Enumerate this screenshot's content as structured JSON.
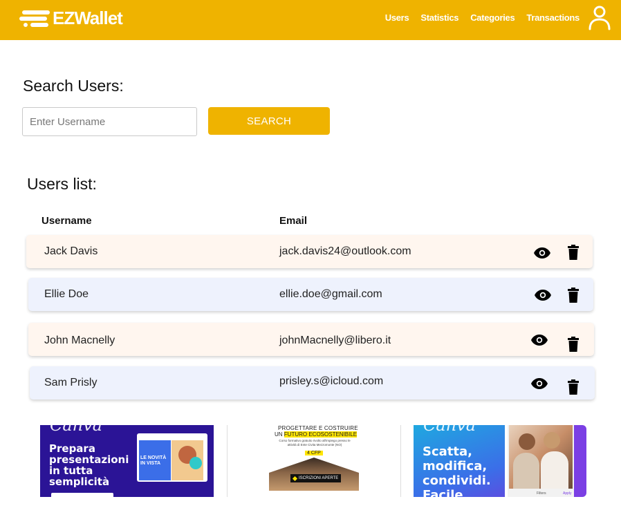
{
  "nav": {
    "brand": "EZWallet",
    "links": [
      "Users",
      "Statistics",
      "Categories",
      "Transactions"
    ]
  },
  "search": {
    "title": "Search Users:",
    "placeholder": "Enter Username",
    "button_label": "SEARCH"
  },
  "users": {
    "title": "Users list:",
    "headers": {
      "username": "Username",
      "email": "Email"
    },
    "rows": [
      {
        "username": "Jack Davis",
        "email": "jack.davis24@outlook.com"
      },
      {
        "username": "Ellie Doe",
        "email": "ellie.doe@gmail.com"
      },
      {
        "username": "John Macnelly",
        "email": "johnMacnelly@libero.it"
      },
      {
        "username": "Sam Prisly",
        "email": "prisley.s@icloud.com"
      }
    ]
  },
  "ads": {
    "ad1": {
      "brand": "Canva",
      "headline": "Prepara presentazioni in tutta semplicità",
      "badge": "LE NOVITÀ IN VISTA"
    },
    "ad2": {
      "line1": "PROGETTARE E COSTRUIRE",
      "line2a": "UN ",
      "line2b": "FUTURO ECOSOSTENIBILE",
      "body": "Corso formativo gratuito rivolto all'impiego presso le attività di Ente Civita Mezzomonte (NO)",
      "credits": "4 CFP",
      "cta": "ISCRIZIONI APERTE"
    },
    "ad3": {
      "brand": "Canva",
      "headline": "Scatta, modifica, condividi. Facile",
      "filters": "Filters",
      "apply": "Apply"
    }
  },
  "colors": {
    "accent": "#efb300",
    "row_warm": "#fff6ef",
    "row_cool": "#eef2fd",
    "canva_purple": "#2b1496",
    "canva_blue": "#3b6ee8"
  }
}
